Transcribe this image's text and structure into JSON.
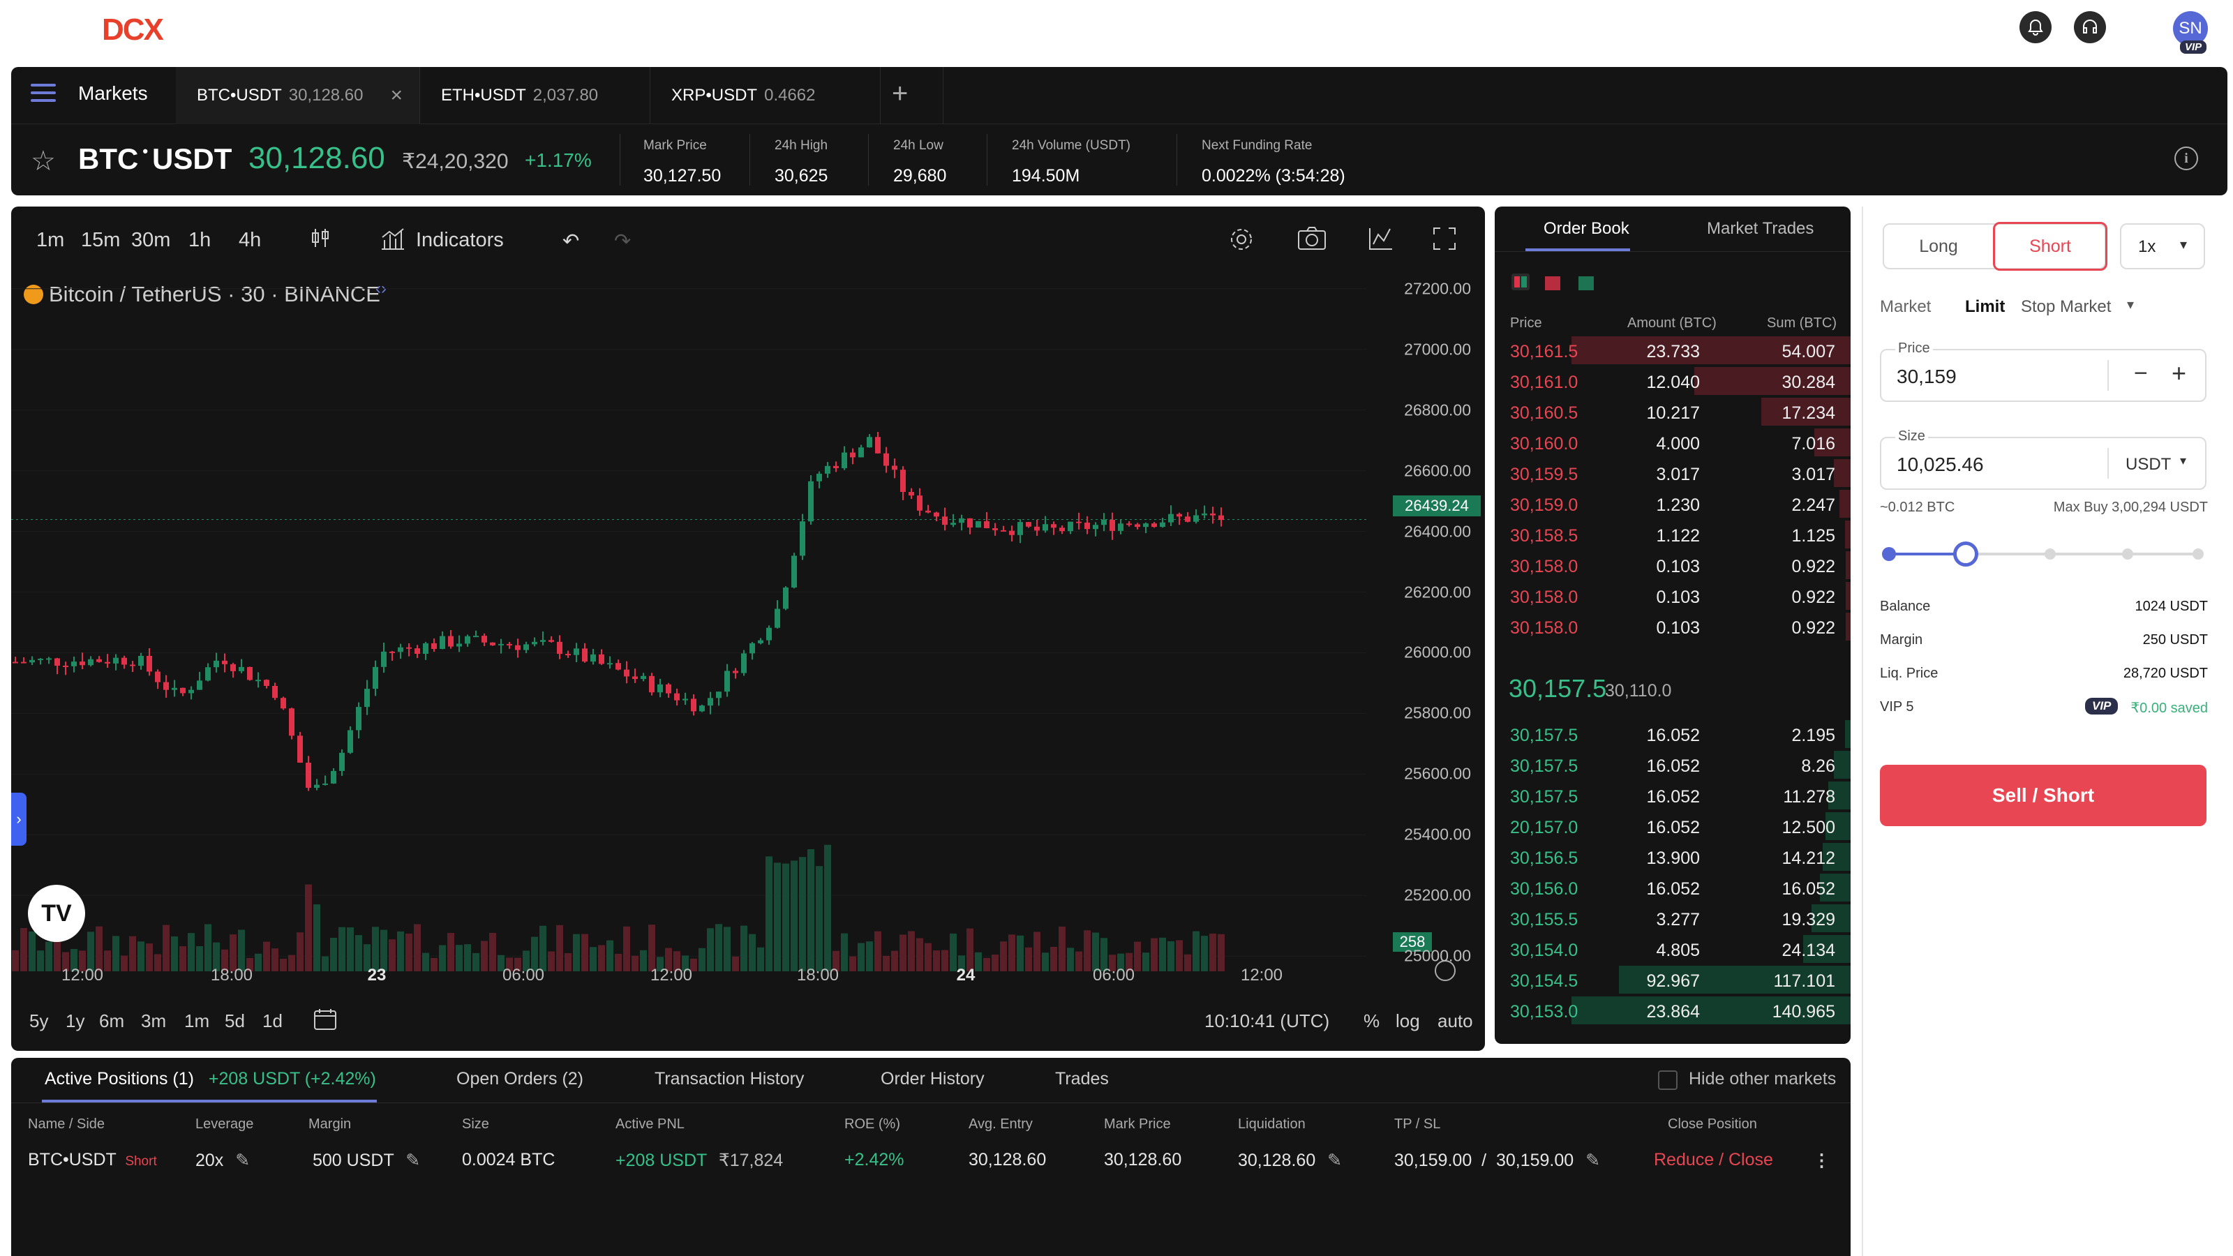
{
  "header": {
    "logo": "DCX",
    "avatar_initials": "SN",
    "vip_badge": "VIP"
  },
  "tabs": {
    "markets_label": "Markets",
    "items": [
      {
        "pair": "BTC•USDT",
        "price": "30,128.60"
      },
      {
        "pair": "ETH•USDT",
        "price": "2,037.80"
      },
      {
        "pair": "XRP•USDT",
        "price": "0.4662"
      }
    ]
  },
  "ticker": {
    "base": "BTC",
    "quote": "USDT",
    "last_price": "30,128.60",
    "inr_price": "₹24,20,320",
    "change": "+1.17%",
    "stats": [
      {
        "label": "Mark Price",
        "value": "30,127.50"
      },
      {
        "label": "24h High",
        "value": "30,625"
      },
      {
        "label": "24h Low",
        "value": "29,680"
      },
      {
        "label": "24h Volume (USDT)",
        "value": "194.50M"
      },
      {
        "label": "Next Funding Rate",
        "value": "0.0022% (3:54:28)"
      }
    ]
  },
  "chart_toolbar": {
    "intervals": [
      "1m",
      "15m",
      "30m",
      "1h",
      "4h"
    ],
    "indicators_label": "Indicators"
  },
  "chart": {
    "symbol_label": "Bitcoin / TetherUS · 30 · BINANCE",
    "price_tag": "26439.24",
    "volume_tag": "258",
    "y_ticks": [
      "27200.00",
      "27000.00",
      "26800.00",
      "26600.00",
      "26400.00",
      "26200.00",
      "26000.00",
      "25800.00",
      "25600.00",
      "25400.00",
      "25200.00",
      "25000.00"
    ],
    "x_ticks": [
      "12:00",
      "18:00",
      "23",
      "06:00",
      "12:00",
      "18:00",
      "24",
      "06:00",
      "12:00"
    ],
    "ranges": [
      "5y",
      "1y",
      "6m",
      "3m",
      "1m",
      "5d",
      "1d"
    ],
    "clock": "10:10:41 (UTC)",
    "pct": "%",
    "log": "log",
    "auto": "auto",
    "tv_logo": "TV"
  },
  "chart_data": {
    "type": "candlestick",
    "ylim": [
      24950,
      27250
    ],
    "last_price": 26439.24,
    "up_color": "#1f8c63",
    "down_color": "#e0334a"
  },
  "order_book": {
    "tabs": [
      "Order Book",
      "Market Trades"
    ],
    "headers": [
      "Price",
      "Amount (BTC)",
      "Sum (BTC)"
    ],
    "asks": [
      [
        "30,161.5",
        "23.733",
        "54.007"
      ],
      [
        "30,161.0",
        "12.040",
        "30.284"
      ],
      [
        "30,160.5",
        "10.217",
        "17.234"
      ],
      [
        "30,160.0",
        "4.000",
        "7.016"
      ],
      [
        "30,159.5",
        "3.017",
        "3.017"
      ],
      [
        "30,159.0",
        "1.230",
        "2.247"
      ],
      [
        "30,158.5",
        "1.122",
        "1.125"
      ],
      [
        "30,158.0",
        "0.103",
        "0.922"
      ],
      [
        "30,158.0",
        "0.103",
        "0.922"
      ],
      [
        "30,158.0",
        "0.103",
        "0.922"
      ]
    ],
    "ask_depth": [
      1.0,
      0.56,
      0.32,
      0.13,
      0.06,
      0.04,
      0.02,
      0.017,
      0.017,
      0.017
    ],
    "mid_price": "30,157.5",
    "mid_sub": "30,110.0",
    "bids": [
      [
        "30,157.5",
        "16.052",
        "2.195"
      ],
      [
        "30,157.5",
        "16.052",
        "8.26"
      ],
      [
        "30,157.5",
        "16.052",
        "11.278"
      ],
      [
        "20,157.0",
        "16.052",
        "12.500"
      ],
      [
        "30,156.5",
        "13.900",
        "14.212"
      ],
      [
        "30,156.0",
        "16.052",
        "16.052"
      ],
      [
        "30,155.5",
        "3.277",
        "19.329"
      ],
      [
        "30,154.0",
        "4.805",
        "24.134"
      ],
      [
        "30,154.5",
        "92.967",
        "117.101"
      ],
      [
        "30,153.0",
        "23.864",
        "140.965"
      ]
    ],
    "bid_depth": [
      0.02,
      0.06,
      0.08,
      0.09,
      0.1,
      0.11,
      0.14,
      0.17,
      0.83,
      1.0
    ]
  },
  "order_form": {
    "long_label": "Long",
    "short_label": "Short",
    "leverage": "1x",
    "types": [
      "Market",
      "Limit",
      "Stop Market"
    ],
    "price_label": "Price",
    "price_value": "30,159",
    "size_label": "Size",
    "size_value": "10,025.46",
    "size_unit": "USDT",
    "approx": "~0.012 BTC",
    "max_buy": "Max Buy 3,00,294 USDT",
    "slider_fraction": 0.25,
    "info": [
      {
        "label": "Balance",
        "value": "1024 USDT"
      },
      {
        "label": "Margin",
        "value": "250 USDT"
      },
      {
        "label": "Liq. Price",
        "value": "28,720 USDT"
      }
    ],
    "vip_level": "VIP 5",
    "vip_badge": "VIP",
    "vip_saved": "₹0.00 saved",
    "submit": "Sell / Short"
  },
  "positions": {
    "tabs": [
      "Active Positions (1)",
      "+208 USDT  (+2.42%)",
      "Open Orders (2)",
      "Transaction History",
      "Order History",
      "Trades"
    ],
    "hide_label": "Hide other markets",
    "headers": [
      "Name / Side",
      "Leverage",
      "Margin",
      "Size",
      "Active PNL",
      "ROE (%)",
      "Avg. Entry",
      "Mark Price",
      "Liquidation",
      "TP / SL",
      "Close Position"
    ],
    "row": {
      "name": "BTC•USDT",
      "side": "Short",
      "leverage": "20x",
      "margin": "500 USDT",
      "size": "0.0024 BTC",
      "pnl": "+208 USDT",
      "pnl_inr": "₹17,824",
      "roe": "+2.42%",
      "entry": "30,128.60",
      "mark": "30,128.60",
      "liq": "30,128.60",
      "tpsl": "30,159.00  /  30,159.00",
      "action": "Reduce / Close"
    }
  }
}
